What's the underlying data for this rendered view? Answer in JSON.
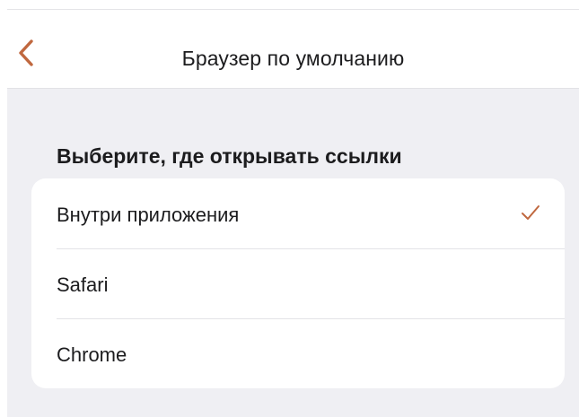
{
  "header": {
    "title": "Браузер по умолчанию",
    "back_icon": "chevron-left-icon"
  },
  "section": {
    "title": "Выберите, где открывать ссылки"
  },
  "options": [
    {
      "label": "Внутри приложения",
      "selected": true
    },
    {
      "label": "Safari",
      "selected": false
    },
    {
      "label": "Chrome",
      "selected": false
    }
  ],
  "colors": {
    "accent": "#c0683f",
    "background": "#efeff3",
    "surface": "#ffffff",
    "text": "#1c1c1e",
    "separator": "#e3e3e7"
  }
}
